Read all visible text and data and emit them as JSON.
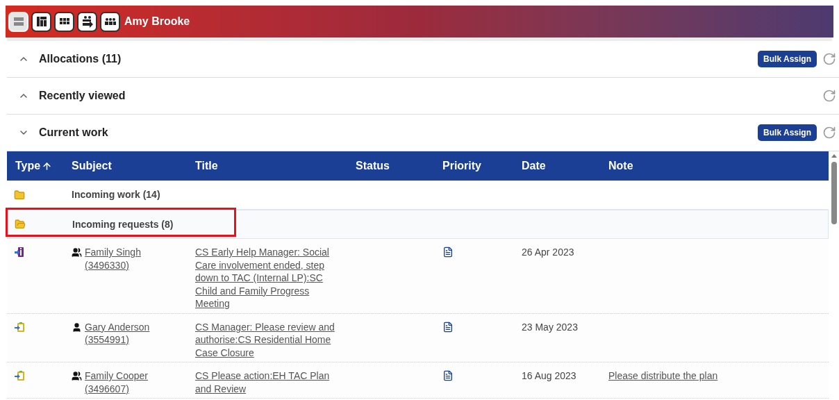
{
  "header": {
    "user": "Amy Brooke",
    "tools": [
      {
        "kind": "list",
        "selected": true
      },
      {
        "kind": "layout",
        "selected": false
      },
      {
        "kind": "grid",
        "selected": false
      },
      {
        "kind": "transfer",
        "selected": false
      },
      {
        "kind": "team",
        "selected": false
      }
    ]
  },
  "sections": [
    {
      "title": "Allocations (11)",
      "expanded": false,
      "button": "Bulk Assign"
    },
    {
      "title": "Recently viewed",
      "expanded": false
    },
    {
      "title": "Current work",
      "expanded": true,
      "button": "Bulk Assign"
    }
  ],
  "table": {
    "columns": [
      {
        "label": "Type",
        "sorted": true
      },
      {
        "label": "Subject",
        "sorted": false
      },
      {
        "label": "Title",
        "sorted": false
      },
      {
        "label": "Status",
        "sorted": false
      },
      {
        "label": "Priority",
        "sorted": false
      },
      {
        "label": "Date",
        "sorted": false
      },
      {
        "label": "Note",
        "sorted": false
      }
    ],
    "folders": [
      {
        "label": "Incoming work (14)",
        "open": false,
        "highlighted": false
      },
      {
        "label": "Incoming requests (8)",
        "open": true,
        "highlighted": true
      }
    ],
    "rows": [
      {
        "kind": "info",
        "subject": {
          "kind": "family",
          "name": "Family Singh",
          "id": "(3496330)"
        },
        "title": "CS Early Help Manager: Social Care involvement ended, step down to TAC (Internal LP):SC Child and Family Progress Meeting",
        "date": "26 Apr 2023"
      },
      {
        "kind": "task",
        "subject": {
          "kind": "person",
          "name": "Gary Anderson",
          "id": "(3554991)"
        },
        "title": "CS Manager: Please review and authorise:CS Residential Home Case Closure",
        "date": "23 May 2023"
      },
      {
        "kind": "task",
        "subject": {
          "kind": "family",
          "name": "Family Cooper",
          "id": "(3496607)"
        },
        "title": "CS Please action:EH TAC Plan and Review",
        "date": "16 Aug 2023",
        "note": "Please distribute the plan"
      }
    ]
  }
}
